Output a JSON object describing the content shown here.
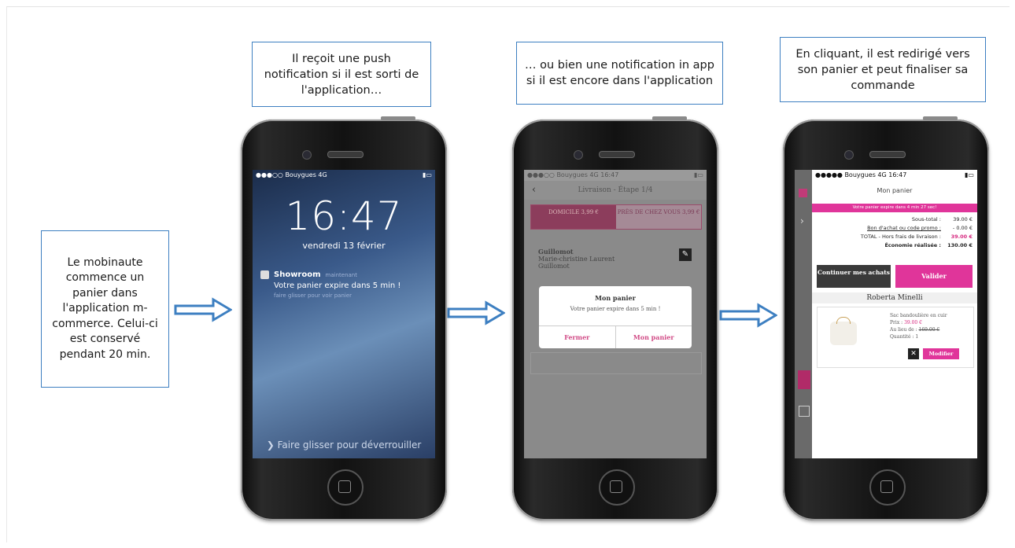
{
  "callouts": {
    "left": "Le mobinaute commence un panier dans l'application m-commerce. Celui-ci est conservé pendant 20 min.",
    "phone1": "Il reçoit une push notification si il est sorti de l'application…",
    "phone2": "… ou bien une notification in app si il est encore dans l'application",
    "phone3": "En cliquant, il est redirigé vers son panier et peut finaliser sa commande"
  },
  "phone1": {
    "carrier": "●●●○○ Bouygues 4G",
    "time": "16:47",
    "date": "vendredi 13 février",
    "notif_app": "Showroom",
    "notif_ago": "maintenant",
    "notif_msg": "Votre panier expire dans 5 min !",
    "notif_sub": "faire glisser pour voir panier",
    "slide": "Faire glisser pour déverrouiller"
  },
  "phone2": {
    "carrier": "●●●○○ Bouygues 4G",
    "time": "16:47",
    "header": "Livraison - Étape 1/4",
    "tab_a": "DOMICILE 3,99 €",
    "tab_b": "PRÈS DE CHEZ VOUS 3,99 €",
    "addr1": "Guillomot",
    "addr2": "Marie-christine Laurent",
    "addr3": "Guillomot",
    "modal_title": "Mon panier",
    "modal_msg": "Votre panier expire dans 5 min !",
    "btn_close": "Fermer",
    "btn_cart": "Mon panier"
  },
  "phone3": {
    "carrier": "●●●●● Bouygues 4G",
    "time": "16:47",
    "title": "Mon panier",
    "banner": "Votre panier expire dans 4 min 27 sec!",
    "rows": [
      {
        "label": "Sous-total :",
        "value": "39.00 €"
      },
      {
        "label": "Bon d'achat ou code promo :",
        "value": "- 0.00 €"
      },
      {
        "label": "TOTAL - Hors frais de livraison :",
        "value": "39.00 €"
      },
      {
        "label": "Économie réalisée :",
        "value": "130.00 €"
      }
    ],
    "btn_continue": "Continuer mes achats",
    "btn_validate": "Valider",
    "brand": "Roberta Minelli",
    "product_name": "Sac bandoulière en cuir",
    "price_label": "Prix :",
    "price": "39.00 €",
    "old_label": "Au lieu de :",
    "old_price": "169.00 €",
    "qty": "Quantité : 1",
    "btn_modify": "Modifier"
  },
  "colors": {
    "callout_border": "#3d7fc1",
    "accent": "#e0359a",
    "arrow": "#3d7fc1"
  }
}
